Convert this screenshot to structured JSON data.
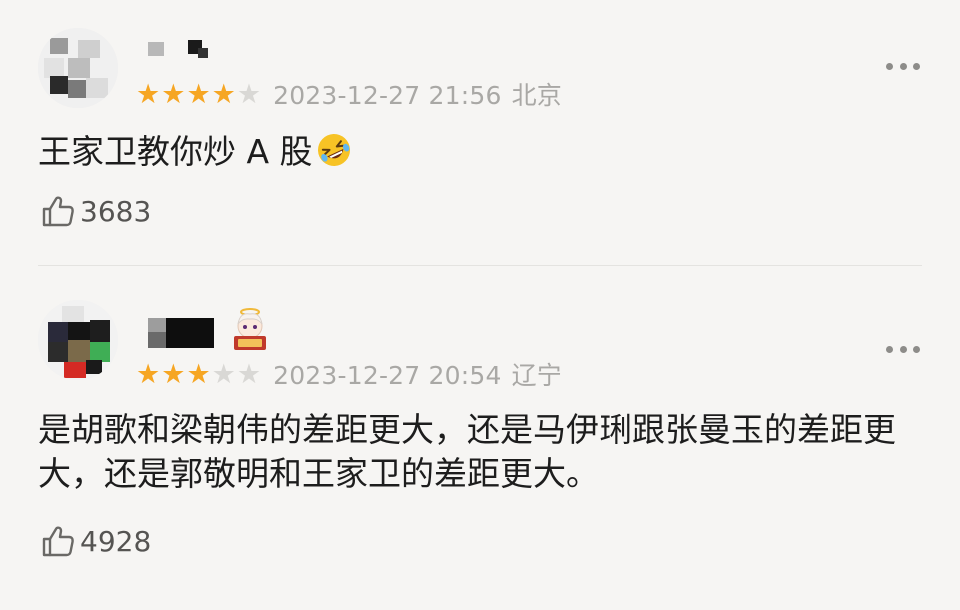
{
  "comments": [
    {
      "rating": 4,
      "stars": [
        "★",
        "★",
        "★",
        "★",
        "★"
      ],
      "date": "2023-12-27 21:56",
      "location": "北京",
      "text": "王家卫教你炒 A 股",
      "emoji": "rolling-on-floor-laughing",
      "likes": "3683"
    },
    {
      "rating": 3,
      "stars": [
        "★",
        "★",
        "★",
        "★",
        "★"
      ],
      "date": "2023-12-27 20:54",
      "location": "辽宁",
      "text": "是胡歌和梁朝伟的差距更大，还是马伊琍跟张曼玉的差距更大，还是郭敬明和王家卫的差距更大。",
      "likes": "4928"
    }
  ],
  "colors": {
    "star_on": "#f6a623",
    "star_off": "#d9d8d5",
    "meta_text": "#a9a8a5",
    "background": "#f6f5f3"
  },
  "icons": {
    "more": "more-dots-icon",
    "like": "thumbs-up-icon"
  }
}
